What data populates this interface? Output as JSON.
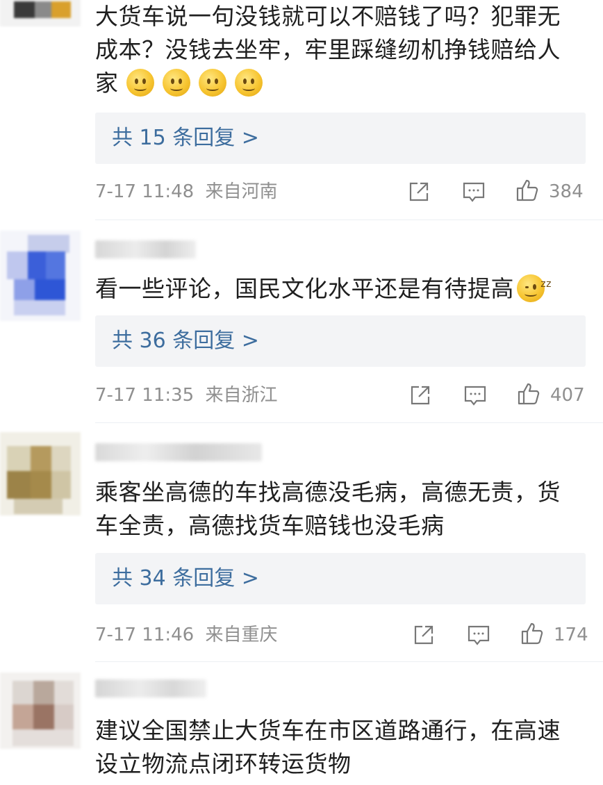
{
  "comments": [
    {
      "text_lines": [
        "大货车说一句没钱就可以不赔钱了吗？犯罪无",
        "成本？没钱去坐牢，牢里踩缝纫机挣钱赔给人",
        "家"
      ],
      "emoji": [
        "smile-emoji",
        "smile-emoji",
        "smile-emoji",
        "smile-emoji"
      ],
      "reply_label": "共 15 条回复 >",
      "time": "7-17 11:48",
      "location": "来自河南",
      "likes": "384"
    },
    {
      "text_lines": [
        "看一些评论，国民文化水平还是有待提高"
      ],
      "emoji": [
        "smug-emoji"
      ],
      "reply_label": "共 36 条回复 >",
      "time": "7-17 11:35",
      "location": "来自浙江",
      "likes": "407"
    },
    {
      "text_lines": [
        "乘客坐高德的车找高德没毛病，高德无责，货",
        "车全责，高德找货车赔钱也没毛病"
      ],
      "reply_label": "共 34 条回复 >",
      "time": "7-17 11:46",
      "location": "来自重庆",
      "likes": "174"
    },
    {
      "text_lines": [
        "建议全国禁止大货车在市区道路通行，在高速",
        "设立物流点闭环转运货物"
      ]
    }
  ],
  "icons": {
    "share": "share-icon",
    "comment": "comment-icon",
    "like": "thumbs-up-icon"
  },
  "colors": {
    "reply_link": "#3d6d9e",
    "meta_text": "#8f8f8f",
    "reply_bg": "#f3f4f6"
  }
}
